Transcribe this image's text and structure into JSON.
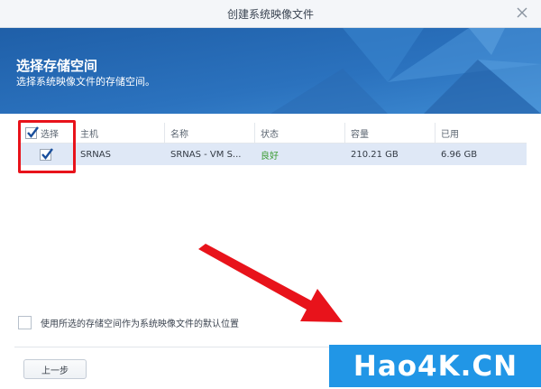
{
  "window": {
    "title": "创建系统映像文件"
  },
  "banner": {
    "title": "选择存储空间",
    "subtitle": "选择系统映像文件的存储空间。"
  },
  "grid": {
    "columns": [
      "选择",
      "主机",
      "名称",
      "状态",
      "容量",
      "已用"
    ],
    "rows": [
      {
        "selected": true,
        "host": "SRNAS",
        "name": "SRNAS - VM S...",
        "status": "良好",
        "capacity": "210.21 GB",
        "used": "6.96 GB"
      }
    ]
  },
  "options": {
    "default_location_label": "使用所选的存储空间作为系统映像文件的默认位置",
    "default_location_checked": false
  },
  "footer": {
    "prev_label": "上一步"
  },
  "watermark": {
    "text": "Hao4K.CN"
  },
  "colors": {
    "banner_blue": "#2a6db5",
    "highlight_red": "#e8131b",
    "status_green": "#3c9c34",
    "watermark_blue": "#2196e6"
  }
}
